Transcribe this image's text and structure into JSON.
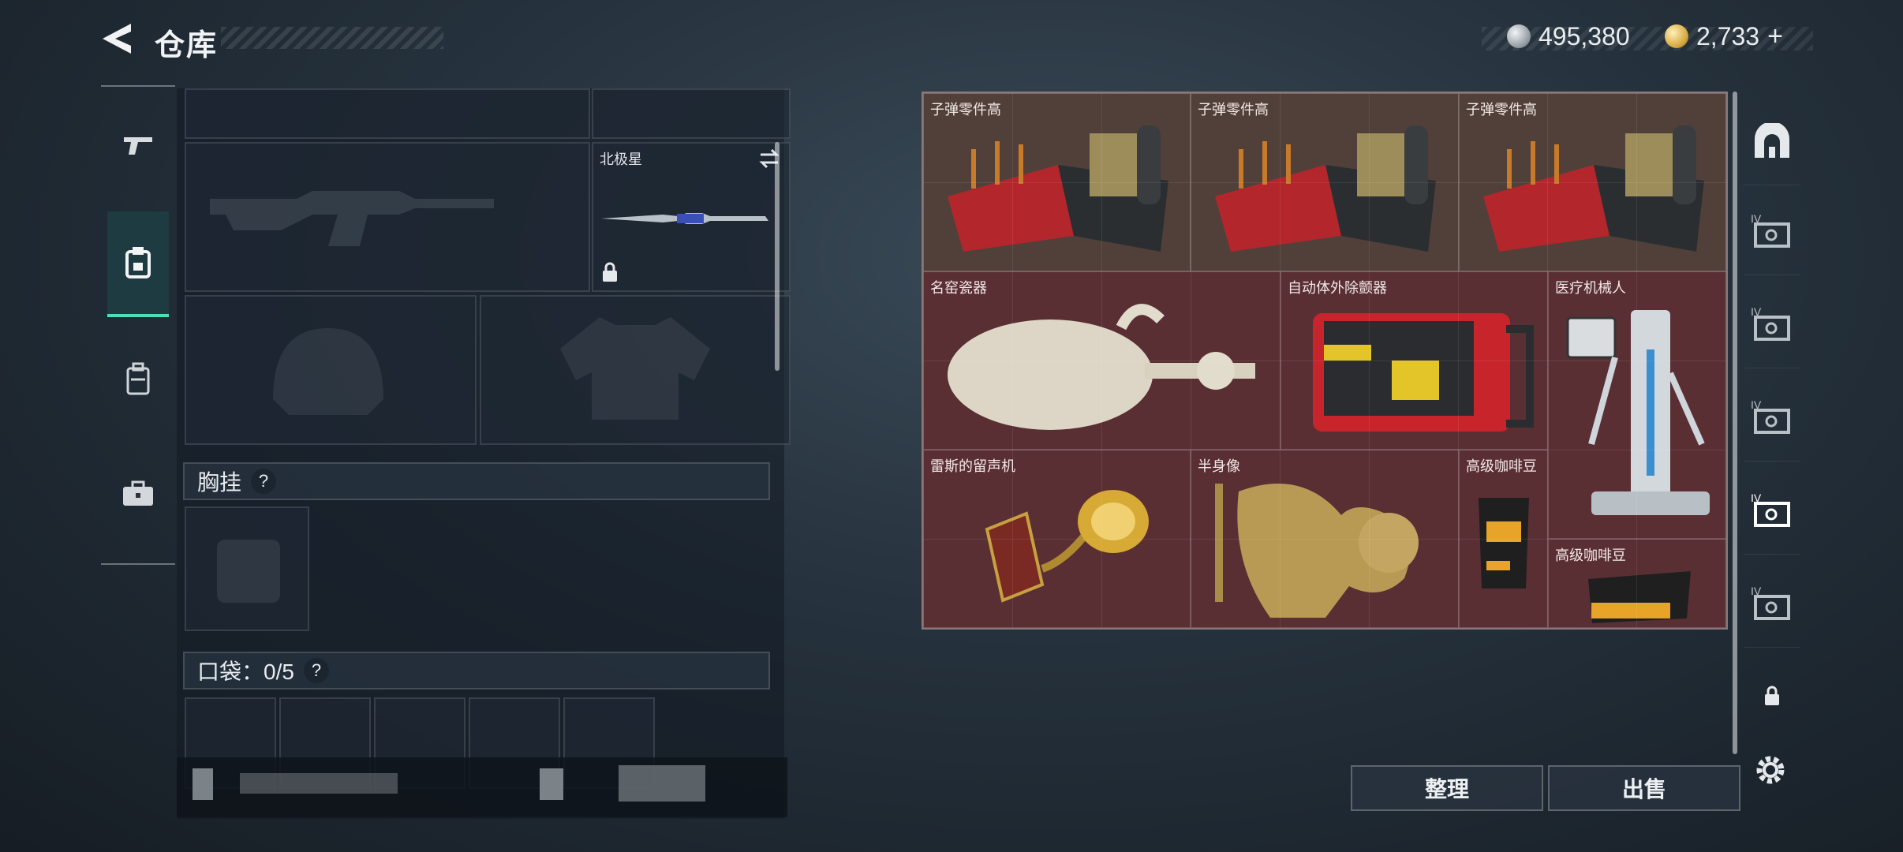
{
  "header": {
    "title": "仓库"
  },
  "currency": {
    "silver": "495,380",
    "gold": "2,733",
    "gold_add": "+"
  },
  "left_nav": [
    {
      "name": "weapon",
      "active": false
    },
    {
      "name": "gear",
      "active": true
    },
    {
      "name": "backpack",
      "active": false
    },
    {
      "name": "case",
      "active": false
    }
  ],
  "loadout": {
    "secondary_label": "北极星",
    "chest_rig_label": "胸挂",
    "chest_rig_help": "?",
    "pocket_label": "口袋：0/5",
    "pocket_help": "?"
  },
  "inventory": {
    "items": [
      {
        "id": "ammo-1",
        "label": "子弹零件高",
        "bg": "brown"
      },
      {
        "id": "ammo-2",
        "label": "子弹零件高",
        "bg": "brown"
      },
      {
        "id": "ammo-3",
        "label": "子弹零件高",
        "bg": "brown"
      },
      {
        "id": "porcelain",
        "label": "名窑瓷器",
        "bg": "red"
      },
      {
        "id": "aed",
        "label": "自动体外除颤器",
        "bg": "red"
      },
      {
        "id": "medical-robot",
        "label": "医疗机械人",
        "bg": "red"
      },
      {
        "id": "gramophone",
        "label": "雷斯的留声机",
        "bg": "red"
      },
      {
        "id": "bust",
        "label": "半身像",
        "bg": "red"
      },
      {
        "id": "coffee-1",
        "label": "高级咖啡豆",
        "bg": "red"
      },
      {
        "id": "coffee-2",
        "label": "高级咖啡豆",
        "bg": "red"
      }
    ]
  },
  "right_nav": [
    {
      "name": "safe-icon",
      "tag": ""
    },
    {
      "name": "stash-page-icon",
      "tag": "IV"
    },
    {
      "name": "stash-page-icon",
      "tag": "IV"
    },
    {
      "name": "stash-page-icon",
      "tag": "IV"
    },
    {
      "name": "stash-page-icon",
      "tag": "IV",
      "active": true
    },
    {
      "name": "stash-page-icon",
      "tag": "IV"
    },
    {
      "name": "lock-icon",
      "tag": ""
    }
  ],
  "actions": {
    "sort": "整理",
    "sell": "出售"
  },
  "colors": {
    "accent": "#4de0b7",
    "item_brown": "#51403a",
    "item_red": "#5a2f34"
  }
}
